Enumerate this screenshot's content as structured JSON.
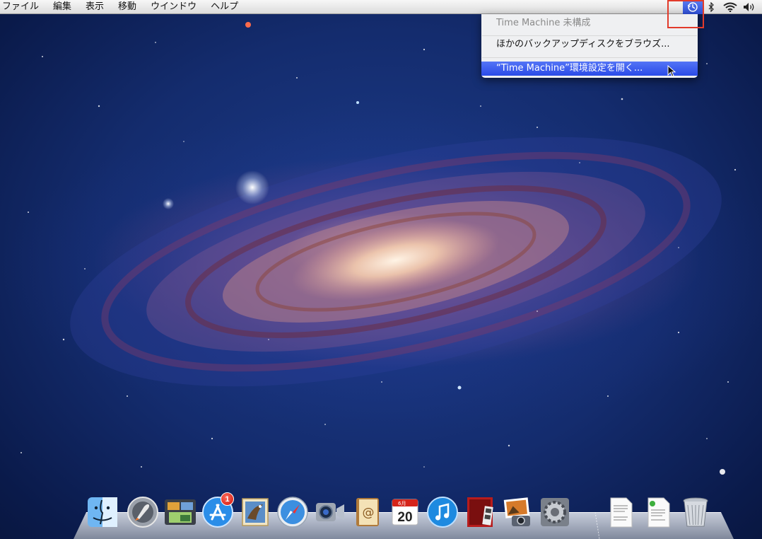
{
  "menubar": {
    "items": [
      "ファイル",
      "編集",
      "表示",
      "移動",
      "ウインドウ",
      "ヘルプ"
    ]
  },
  "status_icons": [
    "time-machine-icon",
    "bluetooth-icon",
    "wifi-icon",
    "volume-icon"
  ],
  "time_machine_menu": {
    "status": "Time Machine 未構成",
    "browse": "ほかのバックアップディスクをブラウズ...",
    "open_prefs": "“Time Machine”環境設定を開く..."
  },
  "dock": {
    "items": [
      "Finder",
      "Launchpad",
      "Mission Control",
      "App Store",
      "Mail",
      "Safari",
      "FaceTime",
      "Address Book",
      "iCal",
      "iTunes",
      "Photo Booth",
      "iPhoto",
      "System Preferences",
      "Document",
      "Document",
      "Trash"
    ],
    "app_store_badge": "1",
    "ical_month": "6月",
    "ical_day": "20"
  }
}
